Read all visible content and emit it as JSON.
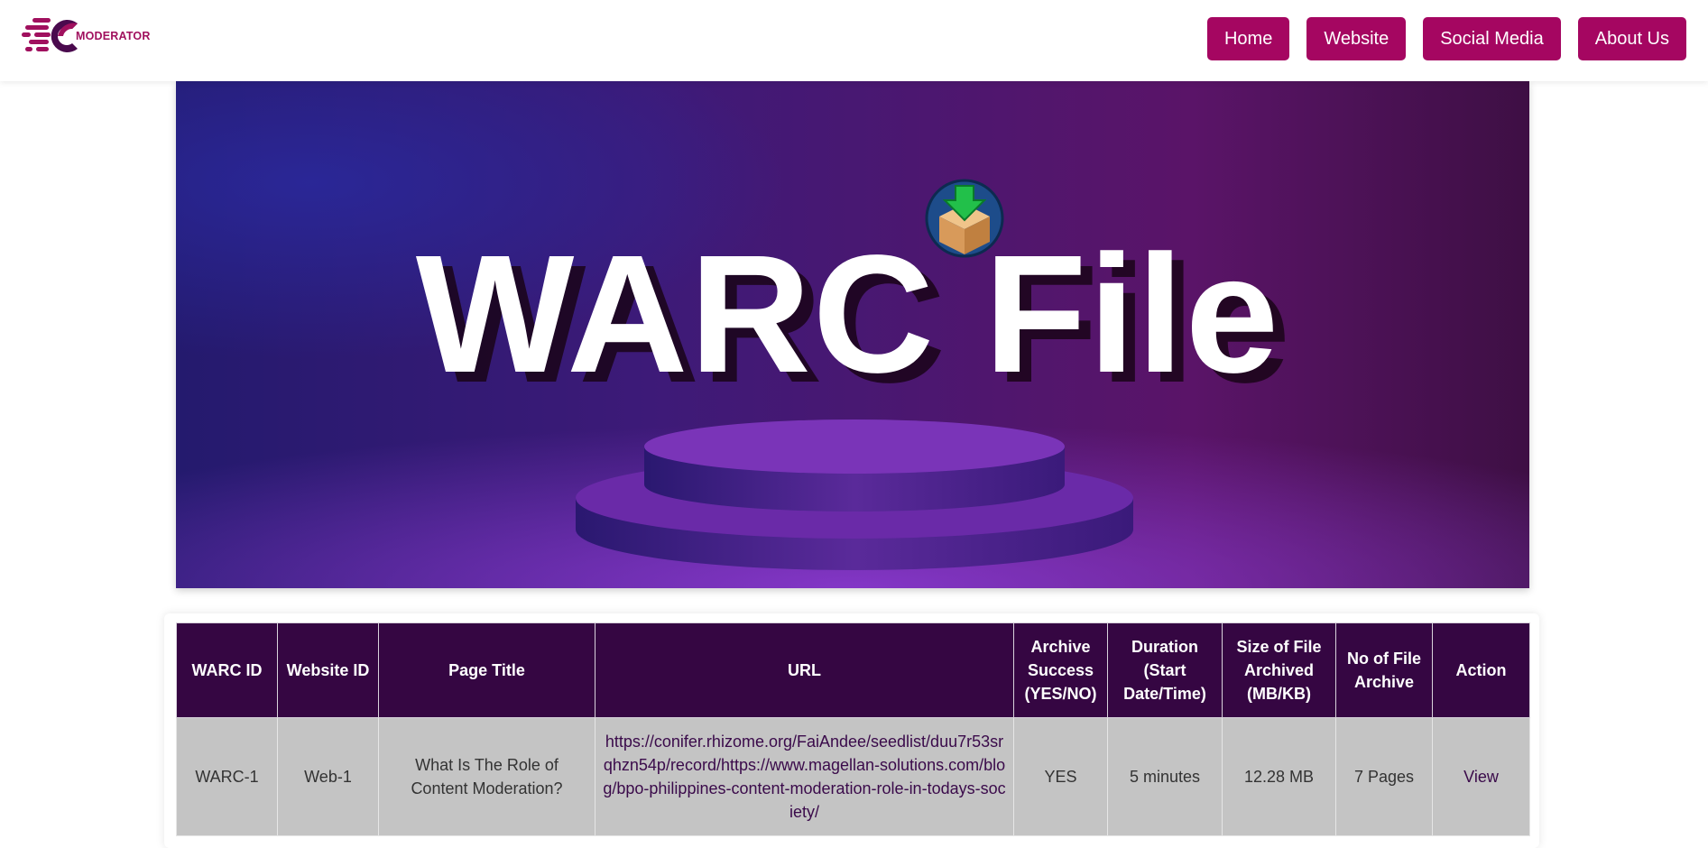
{
  "header": {
    "logo_text": "MODERATOR",
    "nav": [
      "Home",
      "Website",
      "Social Media",
      "About Us"
    ]
  },
  "banner": {
    "title": "WARC File",
    "icon": "download-box-icon"
  },
  "table": {
    "columns": [
      "WARC ID",
      "Website ID",
      "Page Title",
      "URL",
      "Archive Success (YES/NO)",
      "Duration (Start Date/Time)",
      "Size of File Archived (MB/KB)",
      "No of File Archive",
      "Action"
    ],
    "rows": [
      {
        "warc_id": "WARC-1",
        "website_id": "Web-1",
        "page_title": "What Is The Role of Content Moderation?",
        "url": "https://conifer.rhizome.org/FaiAndee/seedlist/duu7r53srqhzn54p/record/https://www.magellan-solutions.com/blog/bpo-philippines-content-moderation-role-in-todays-society/",
        "archive_success": "YES",
        "duration": "5 minutes",
        "size": "12.28 MB",
        "no_of_files": "7 Pages",
        "action": "View"
      }
    ]
  },
  "colors": {
    "brand": "#a50661",
    "table_header": "#350642",
    "row_bg": "#c4c4c4"
  }
}
